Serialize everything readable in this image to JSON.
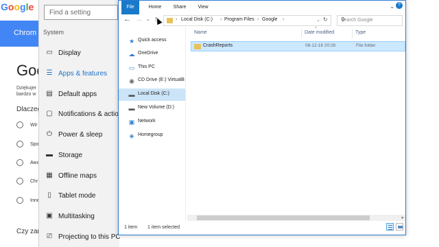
{
  "background_page": {
    "logo": "Google",
    "band_text": "Chrom",
    "big_title": "Goo",
    "small_text_1": "Dziękujer",
    "small_text_2": "bardzo w",
    "question": "Dlaczeg",
    "radio_options": [
      "Wir",
      "Spo",
      "Awa",
      "Chr",
      "Inne"
    ],
    "bottom_question": "Czy zam",
    "colors": {
      "band": "#4285f4",
      "logo_g": "#4285f4",
      "logo_o1": "#ea4335",
      "logo_o2": "#fbbc05",
      "logo_g2": "#4285f4",
      "logo_l": "#34a853",
      "logo_e": "#ea4335"
    }
  },
  "settings": {
    "search_placeholder": "Find a setting",
    "section_label": "System",
    "items": [
      {
        "label": "Display",
        "icon": "display-icon"
      },
      {
        "label": "Apps & features",
        "icon": "apps-list-icon",
        "active": true
      },
      {
        "label": "Default apps",
        "icon": "default-apps-icon"
      },
      {
        "label": "Notifications & action",
        "icon": "notifications-icon"
      },
      {
        "label": "Power & sleep",
        "icon": "power-icon"
      },
      {
        "label": "Storage",
        "icon": "storage-icon"
      },
      {
        "label": "Offline maps",
        "icon": "map-icon"
      },
      {
        "label": "Tablet mode",
        "icon": "tablet-icon"
      },
      {
        "label": "Multitasking",
        "icon": "multitasking-icon"
      },
      {
        "label": "Projecting to this PC",
        "icon": "projecting-icon"
      }
    ],
    "accent_color": "#1e73c8"
  },
  "explorer": {
    "ribbon_tabs": [
      "File",
      "Home",
      "Share",
      "View"
    ],
    "address": {
      "crumbs": [
        "Local Disk (C:)",
        "Program Files",
        "Google"
      ]
    },
    "search_placeholder": "Search Google",
    "nav_pane": [
      {
        "label": "Quick access",
        "icon": "star-icon"
      },
      {
        "label": "OneDrive",
        "icon": "cloud-icon"
      },
      {
        "label": "This PC",
        "icon": "computer-icon"
      },
      {
        "label": "CD Drive (E:) VirtualB",
        "icon": "cd-drive-icon"
      },
      {
        "label": "Local Disk (C:)",
        "icon": "drive-icon",
        "selected": true
      },
      {
        "label": "New Volume (D:)",
        "icon": "drive-icon"
      },
      {
        "label": "Network",
        "icon": "network-icon"
      },
      {
        "label": "Homegroup",
        "icon": "homegroup-icon"
      }
    ],
    "columns": [
      "Name",
      "Date modified",
      "Type"
    ],
    "files": [
      {
        "name": "CrashReports",
        "date": "08-12-16 20:26",
        "type": "File folder"
      }
    ],
    "status": {
      "item_count": "1 item",
      "selected": "1 item selected"
    },
    "colors": {
      "file_tab": "#1979ca",
      "selection": "#cce8ff",
      "folder": "#e7c15a"
    }
  }
}
